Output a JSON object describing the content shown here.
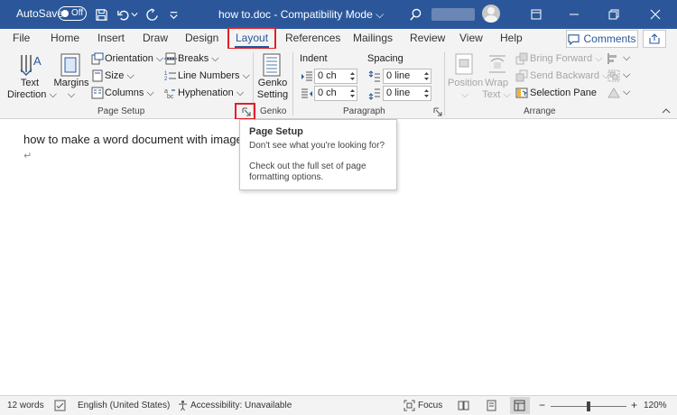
{
  "titlebar": {
    "autosave_label": "AutoSave",
    "autosave_state": "Off",
    "title": "how to.doc  -  Compatibility Mode",
    "title_chevron": "⌵"
  },
  "tabs": [
    {
      "label": "File"
    },
    {
      "label": "Home"
    },
    {
      "label": "Insert"
    },
    {
      "label": "Draw"
    },
    {
      "label": "Design"
    },
    {
      "label": "Layout",
      "active": true
    },
    {
      "label": "References"
    },
    {
      "label": "Mailings"
    },
    {
      "label": "Review"
    },
    {
      "label": "View"
    },
    {
      "label": "Help"
    }
  ],
  "comments_label": "Comments",
  "ribbon": {
    "page_setup": {
      "text_direction": "Text\nDirection ⌵",
      "margins": "Margins\n⌵",
      "orientation": "Orientation ⌵",
      "size": "Size ⌵",
      "columns": "Columns ⌵",
      "breaks": "Breaks ⌵",
      "line_numbers": "Line Numbers ⌵",
      "hyphenation": "Hyphenation ⌵",
      "group": "Page Setup"
    },
    "genko": {
      "setting": "Genko\nSetting",
      "group": "Genko"
    },
    "paragraph": {
      "indent": "Indent",
      "spacing": "Spacing",
      "indent_left": "0 ch",
      "indent_right": "0 ch",
      "spacing_before": "0 line",
      "spacing_after": "0 line",
      "group": "Paragraph"
    },
    "arrange": {
      "position": "Position\n⌵",
      "wrap_text": "Wrap\nText ⌵",
      "bring_forward": "Bring Forward ⌵",
      "send_backward": "Send Backward ⌵",
      "selection_pane": "Selection Pane",
      "group": "Arrange"
    }
  },
  "document": {
    "text": "how to make a word document with image",
    "para_mark": "↵"
  },
  "tooltip": {
    "title": "Page Setup",
    "question": "Don't see what you're looking for?",
    "body": "Check out the full set of page formatting options."
  },
  "statusbar": {
    "words": "12 words",
    "language": "English (United States)",
    "accessibility": "Accessibility: Unavailable",
    "focus": "Focus",
    "zoom_minus": "−",
    "zoom_plus": "+",
    "zoom": "120%"
  },
  "colors": {
    "title_bar": "#2b579a",
    "highlight": "#e0202a"
  }
}
